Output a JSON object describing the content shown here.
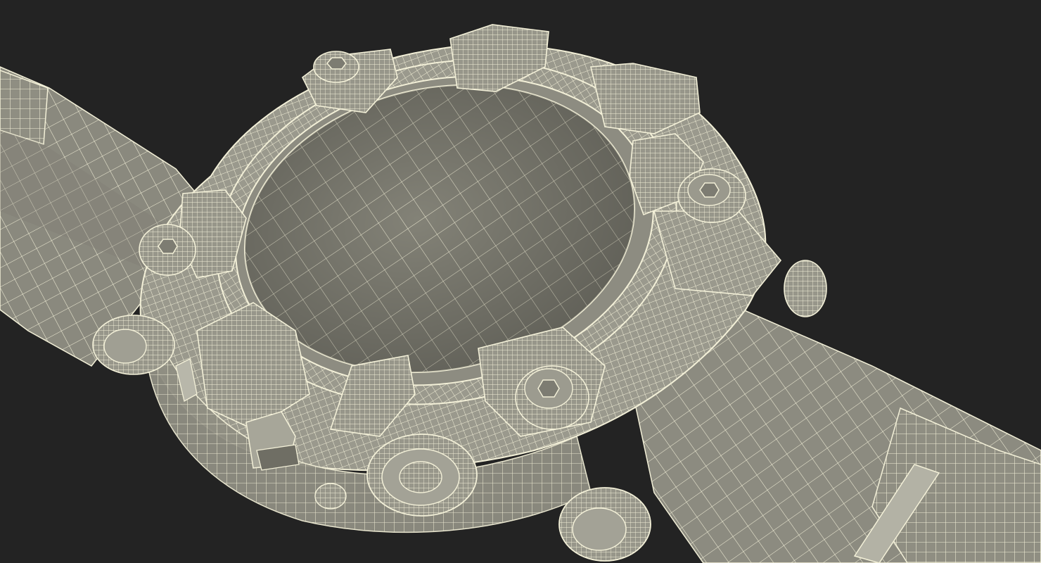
{
  "scene": {
    "subject": "wristwatch-wireframe-render",
    "colors": {
      "background": "#232323",
      "surface": "#8f8e82",
      "surface_light": "#a9a89b",
      "surface_dark": "#6f6e64",
      "wire": "#f3f0d8",
      "shadow": "#4a4942"
    }
  }
}
